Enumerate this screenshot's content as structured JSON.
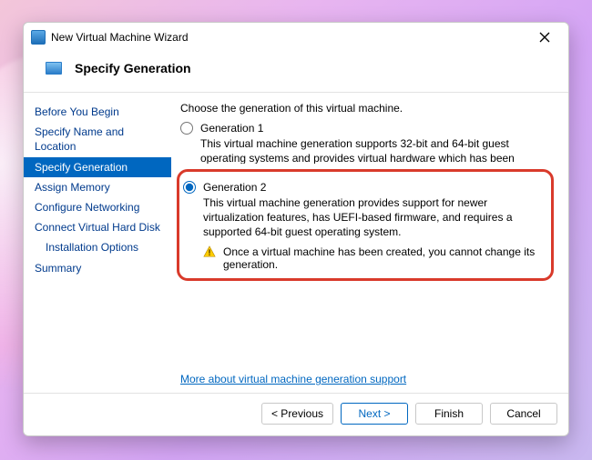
{
  "window": {
    "title": "New Virtual Machine Wizard"
  },
  "heading": "Specify Generation",
  "sidebar": {
    "items": [
      {
        "label": "Before You Begin",
        "selected": false
      },
      {
        "label": "Specify Name and Location",
        "selected": false
      },
      {
        "label": "Specify Generation",
        "selected": true
      },
      {
        "label": "Assign Memory",
        "selected": false
      },
      {
        "label": "Configure Networking",
        "selected": false
      },
      {
        "label": "Connect Virtual Hard Disk",
        "selected": false
      },
      {
        "label": "Installation Options",
        "selected": false,
        "indent": true
      },
      {
        "label": "Summary",
        "selected": false
      }
    ]
  },
  "content": {
    "intro": "Choose the generation of this virtual machine.",
    "gen1": {
      "label": "Generation 1",
      "desc": "This virtual machine generation supports 32-bit and 64-bit guest operating systems and provides virtual hardware which has been available in all previous versions of Hyper-V."
    },
    "gen2": {
      "label": "Generation 2",
      "desc": "This virtual machine generation provides support for newer virtualization features, has UEFI-based firmware, and requires a supported 64-bit guest operating system."
    },
    "warning": "Once a virtual machine has been created, you cannot change its generation.",
    "link": "More about virtual machine generation support"
  },
  "buttons": {
    "previous": "< Previous",
    "next": "Next >",
    "finish": "Finish",
    "cancel": "Cancel"
  }
}
